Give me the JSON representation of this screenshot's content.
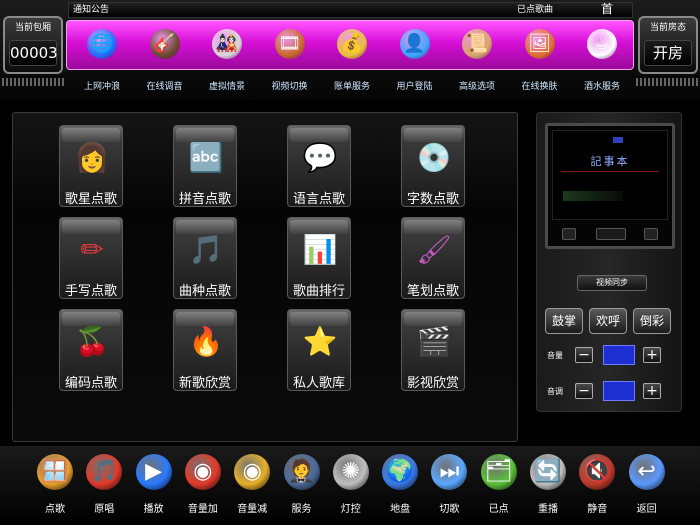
{
  "header": {
    "notice_label": "通知公告",
    "played_label": "已点歌曲",
    "home_label": "首",
    "left_box": {
      "title": "当前包厢",
      "value": "00003"
    },
    "right_box": {
      "title": "当前房态",
      "value": "开房"
    }
  },
  "menu": [
    {
      "label": "上网冲浪",
      "icon": "firefox-globe-icon",
      "glyph": "🌐"
    },
    {
      "label": "在线调音",
      "icon": "guitar-icon",
      "glyph": "🎸"
    },
    {
      "label": "虚拟情景",
      "icon": "doll-icon",
      "glyph": "🎎"
    },
    {
      "label": "视频切换",
      "icon": "video-switch-icon",
      "glyph": "🎞"
    },
    {
      "label": "账单服务",
      "icon": "gold-bill-icon",
      "glyph": "💰"
    },
    {
      "label": "用户登陆",
      "icon": "user-login-icon",
      "glyph": "👤"
    },
    {
      "label": "高级选项",
      "icon": "scroll-options-icon",
      "glyph": "📜"
    },
    {
      "label": "在线换肤",
      "icon": "skin-picture-icon",
      "glyph": "🖼"
    },
    {
      "label": "酒水服务",
      "icon": "coffee-cup-icon",
      "glyph": "☕"
    }
  ],
  "tiles": [
    {
      "label": "歌星点歌",
      "icon": "singer-icon",
      "glyph": "👩"
    },
    {
      "label": "拼音点歌",
      "icon": "abc-keyboard-icon",
      "glyph": "🔤"
    },
    {
      "label": "语言点歌",
      "icon": "speech-bubble-icon",
      "glyph": "💬"
    },
    {
      "label": "字数点歌",
      "icon": "number-disc-icon",
      "glyph": "💿"
    },
    {
      "label": "手写点歌",
      "icon": "pen-write-icon",
      "glyph": "✏"
    },
    {
      "label": "曲种点歌",
      "icon": "music-disc-icon",
      "glyph": "🎵"
    },
    {
      "label": "歌曲排行",
      "icon": "bar-chart-icon",
      "glyph": "📊"
    },
    {
      "label": "笔划点歌",
      "icon": "stroke-brush-icon",
      "glyph": "🖌"
    },
    {
      "label": "编码点歌",
      "icon": "slot-cherry-icon",
      "glyph": "🍒"
    },
    {
      "label": "新歌欣赏",
      "icon": "new-fire-icon",
      "glyph": "🔥"
    },
    {
      "label": "私人歌库",
      "icon": "star-icon",
      "glyph": "⭐"
    },
    {
      "label": "影视欣赏",
      "icon": "film-icon",
      "glyph": "🎬"
    }
  ],
  "right_panel": {
    "video_title": "記事本",
    "sync_label": "视频同步",
    "fx_buttons": [
      "鼓掌",
      "欢呼",
      "倒彩"
    ],
    "volume_label": "音量",
    "pitch_label": "音调",
    "minus_glyph": "−",
    "plus_glyph": "+"
  },
  "dock": [
    {
      "label": "点歌",
      "icon": "windows-logo-icon",
      "glyph": "🪟"
    },
    {
      "label": "原唱",
      "icon": "music-note-icon",
      "glyph": "🎵"
    },
    {
      "label": "播放",
      "icon": "play-icon",
      "glyph": "▶"
    },
    {
      "label": "音量加",
      "icon": "volume-up-disc-icon",
      "glyph": "◉"
    },
    {
      "label": "音量减",
      "icon": "volume-down-disc-icon",
      "glyph": "◉"
    },
    {
      "label": "服务",
      "icon": "waiter-icon",
      "glyph": "🤵"
    },
    {
      "label": "灯控",
      "icon": "light-control-icon",
      "glyph": "✺"
    },
    {
      "label": "地盘",
      "icon": "globe-icon",
      "glyph": "🌍"
    },
    {
      "label": "切歌",
      "icon": "switch-song-icon",
      "glyph": "⏭"
    },
    {
      "label": "已点",
      "icon": "selected-list-icon",
      "glyph": "🗂"
    },
    {
      "label": "重播",
      "icon": "replay-icon",
      "glyph": "🔄"
    },
    {
      "label": "静音",
      "icon": "mute-icon",
      "glyph": "🔇"
    },
    {
      "label": "返回",
      "icon": "back-arrow-icon",
      "glyph": "↩"
    }
  ]
}
